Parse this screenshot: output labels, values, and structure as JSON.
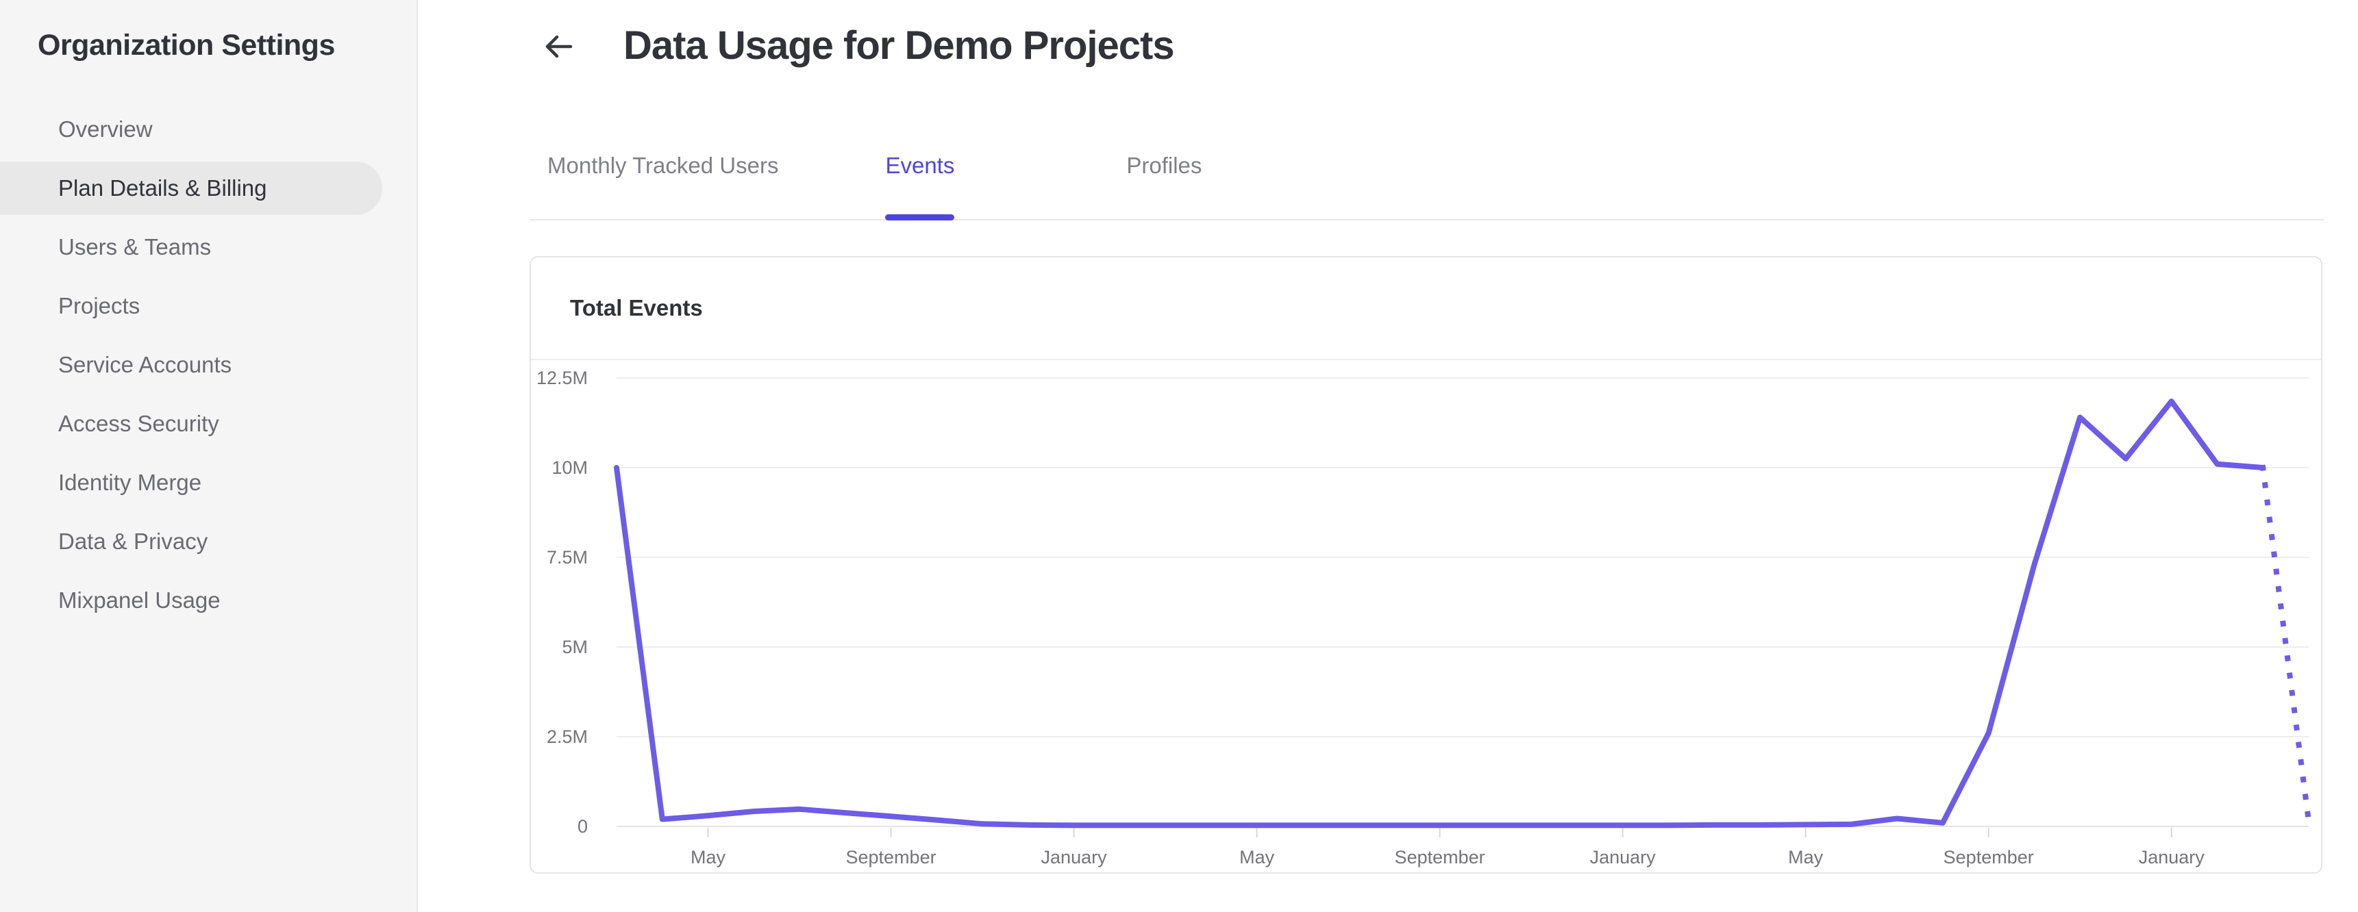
{
  "sidebar": {
    "title": "Organization Settings",
    "items": [
      {
        "label": "Overview",
        "active": false
      },
      {
        "label": "Plan Details & Billing",
        "active": true
      },
      {
        "label": "Users & Teams",
        "active": false
      },
      {
        "label": "Projects",
        "active": false
      },
      {
        "label": "Service Accounts",
        "active": false
      },
      {
        "label": "Access Security",
        "active": false
      },
      {
        "label": "Identity Merge",
        "active": false
      },
      {
        "label": "Data & Privacy",
        "active": false
      },
      {
        "label": "Mixpanel Usage",
        "active": false
      }
    ]
  },
  "header": {
    "back_icon": "arrow-left",
    "title": "Data Usage for Demo Projects"
  },
  "tabs": [
    {
      "label": "Monthly Tracked Users",
      "active": false
    },
    {
      "label": "Events",
      "active": true
    },
    {
      "label": "Profiles",
      "active": false
    }
  ],
  "card": {
    "title": "Total Events"
  },
  "colors": {
    "accent": "#4f44e0",
    "line": "#6c5ce8",
    "grid": "#eeeef0",
    "axis": "#e3e3e6",
    "tick": "#d8d8db",
    "axis_text": "#73737a"
  },
  "chart_data": {
    "type": "line",
    "title": "Total Events",
    "grid": "horizontal",
    "legend": "none",
    "ylim_millions": [
      0,
      12.5
    ],
    "y_tick_labels": [
      "0",
      "2.5M",
      "5M",
      "7.5M",
      "10M",
      "12.5M"
    ],
    "y_tick_values_millions": [
      0,
      2.5,
      5,
      7.5,
      10,
      12.5
    ],
    "x_tick_labels": [
      "May",
      "September",
      "January",
      "May",
      "September",
      "January",
      "May",
      "September",
      "January"
    ],
    "x_tick_indices": [
      2,
      6,
      10,
      14,
      18,
      22,
      26,
      30,
      34
    ],
    "series": [
      {
        "name": "Total Events",
        "values_millions": [
          10,
          0.2,
          0.3,
          0.42,
          0.48,
          0.38,
          0.28,
          0.18,
          0.07,
          0.04,
          0.03,
          0.03,
          0.03,
          0.03,
          0.03,
          0.03,
          0.03,
          0.03,
          0.03,
          0.03,
          0.03,
          0.03,
          0.03,
          0.03,
          0.04,
          0.04,
          0.05,
          0.06,
          0.22,
          0.1,
          2.6,
          7.3,
          11.4,
          10.25,
          11.85,
          10.1,
          10,
          0.15
        ],
        "solid_through_index": 36,
        "projected_dotted_from_index": 36
      }
    ]
  }
}
